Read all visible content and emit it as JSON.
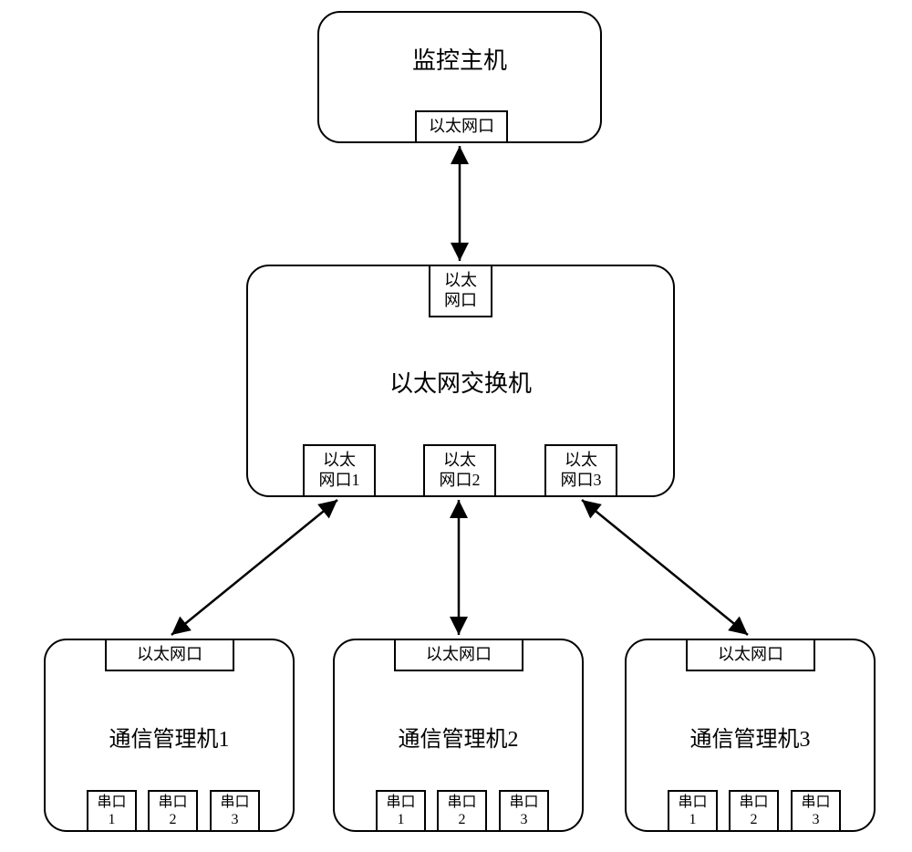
{
  "monitor": {
    "title": "监控主机",
    "port": "以太网口"
  },
  "switch": {
    "title": "以太网交换机",
    "topPort": "以太\n网口",
    "port1": "以太\n网口1",
    "port2": "以太\n网口2",
    "port3": "以太\n网口3"
  },
  "comm1": {
    "title": "通信管理机1",
    "ethPort": "以太网口",
    "serial1": "串口\n1",
    "serial2": "串口\n2",
    "serial3": "串口\n3"
  },
  "comm2": {
    "title": "通信管理机2",
    "ethPort": "以太网口",
    "serial1": "串口\n1",
    "serial2": "串口\n2",
    "serial3": "串口\n3"
  },
  "comm3": {
    "title": "通信管理机3",
    "ethPort": "以太网口",
    "serial1": "串口\n1",
    "serial2": "串口\n2",
    "serial3": "串口\n3"
  }
}
